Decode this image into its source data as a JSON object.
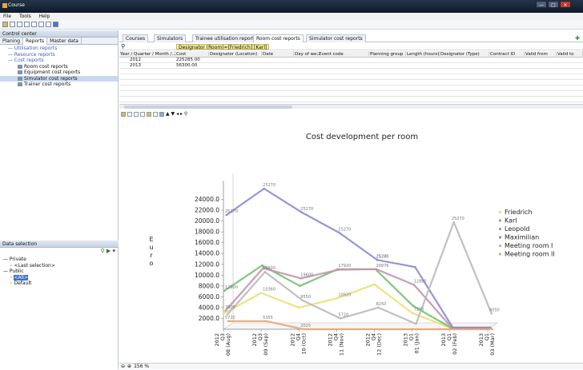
{
  "window": {
    "title": "Course",
    "controls": [
      "—",
      "□",
      "✕"
    ]
  },
  "menu": [
    "File",
    "Tools",
    "Help"
  ],
  "left": {
    "header": "Control center",
    "tabs": [
      "Planing",
      "Reports",
      "Master data"
    ],
    "tree": [
      {
        "label": "Utilisation reports",
        "level": 1,
        "type": "link"
      },
      {
        "label": "Resource reports",
        "level": 1,
        "type": "link"
      },
      {
        "label": "Cost reports",
        "level": 1,
        "type": "link"
      },
      {
        "label": "Room cost reports",
        "level": 2,
        "type": "item"
      },
      {
        "label": "Equipment cost reports",
        "level": 2,
        "type": "item"
      },
      {
        "label": "Simulator cost reports",
        "level": 2,
        "type": "item",
        "selected": true
      },
      {
        "label": "Trainer cost reports",
        "level": 2,
        "type": "item"
      }
    ],
    "data_selection": {
      "header": "Data selection",
      "items": [
        {
          "label": "Private",
          "level": 0
        },
        {
          "label": "<Last selection>",
          "level": 1
        },
        {
          "label": "Public",
          "level": 0
        },
        {
          "label": "<All>",
          "level": 1,
          "selected": true
        },
        {
          "label": "Default",
          "level": 1
        }
      ]
    }
  },
  "tabs": [
    "Courses",
    "Simulators",
    "Trainee utilisation reports",
    "Room cost reports",
    "Simulator cost reports"
  ],
  "filter": "Designator (Room)=[Friedrich] [Karl]",
  "grid": {
    "columns": [
      "Year / Quarter / Month /...",
      "Cost",
      "Designator (Location)",
      "Date",
      "Day of we...",
      "Event code",
      "Planning group",
      "Length (hours)",
      "Designator (Type)",
      "Contract ID",
      "Valid from",
      "Valid to"
    ],
    "rows": [
      [
        "2012",
        "225285.00"
      ],
      [
        "2013",
        "56300.00"
      ]
    ]
  },
  "status": {
    "zoom": "156 %"
  },
  "chart_data": {
    "type": "line",
    "title": "Cost development per room",
    "ylabel": "Euro",
    "ylim": [
      0,
      26000
    ],
    "yticks": [
      "24000.0",
      "22000.0",
      "20000.0",
      "18000.0",
      "16000.0",
      "14000.0",
      "12000.0",
      "10000.0",
      "8000.0",
      "6000.0",
      "4000.0",
      "2000.0"
    ],
    "categories": [
      "2012 Q3 08 (Aug)",
      "2012 Q3 09 (Sep)",
      "2012 Q4 10 (Oct)",
      "2012 Q4 11 (Nov)",
      "2012 Q4 12 (Dec)",
      "2013 Q1 01 (Jan)",
      "2013 Q1 02 (Feb)",
      "2013 Q1 03 (Mar)"
    ],
    "series": [
      {
        "name": "Friedrich",
        "color": "#ece073",
        "values": [
          2900,
          6700,
          4000,
          5700,
          8300,
          3000,
          300,
          300
        ]
      },
      {
        "name": "Karl",
        "color": "#6fc26a",
        "values": [
          7100,
          11800,
          8000,
          11100,
          11100,
          4300,
          300,
          300
        ]
      },
      {
        "name": "Leopold",
        "color": "#c890b0",
        "values": [
          3400,
          11300,
          9400,
          11000,
          11100,
          8200,
          300,
          300
        ]
      },
      {
        "name": "Maximilian",
        "color": "#8a8ad0",
        "values": [
          21100,
          26000,
          21600,
          17800,
          12800,
          11500,
          300,
          300
        ]
      },
      {
        "name": "Meeting room I",
        "color": "#b9b9b9",
        "values": [
          2700,
          10600,
          5300,
          2000,
          4000,
          1000,
          19800,
          2900
        ]
      },
      {
        "name": "Meeting room II",
        "color": "#e3a97a",
        "values": [
          1500,
          1500,
          0,
          0,
          0,
          0,
          0,
          0
        ]
      }
    ],
    "data_labels": [
      {
        "text": "25270"
      },
      {
        "text": "21200"
      },
      {
        "text": "20976"
      },
      {
        "text": "17920"
      },
      {
        "text": "16920"
      },
      {
        "text": "19600"
      },
      {
        "text": "12880"
      },
      {
        "text": "12900"
      },
      {
        "text": "10360"
      },
      {
        "text": "10920"
      },
      {
        "text": "9550"
      },
      {
        "text": "8250"
      },
      {
        "text": "7150"
      },
      {
        "text": "5720"
      },
      {
        "text": "5720"
      },
      {
        "text": "5355"
      },
      {
        "text": "4050"
      },
      {
        "text": "3800"
      },
      {
        "text": "2025"
      },
      {
        "text": "1620"
      },
      {
        "text": "1620"
      },
      {
        "text": "2960"
      },
      {
        "text": "3550"
      },
      {
        "text": "0"
      }
    ]
  }
}
